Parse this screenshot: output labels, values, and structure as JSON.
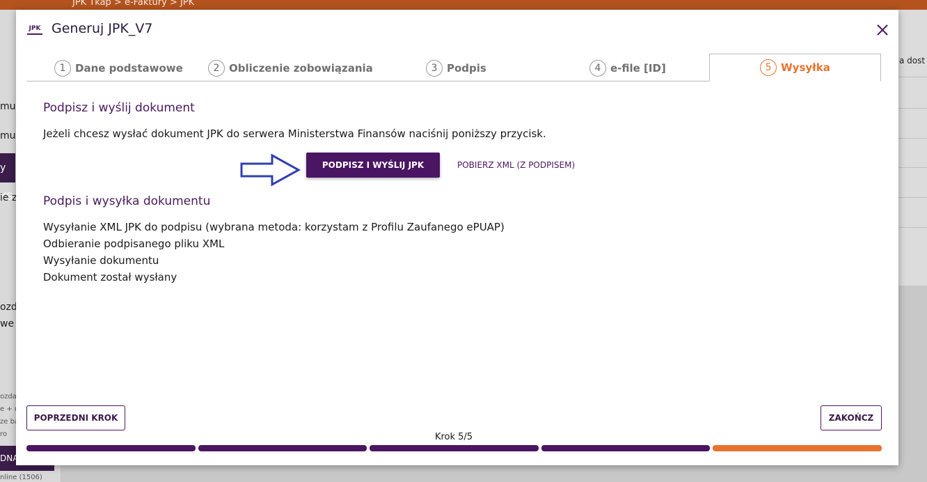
{
  "background": {
    "breadcrumb": "JPK   Tkap  >  e-Faktury  >  JPK",
    "left_texts": [
      "mul",
      "mul",
      "ie z",
      "ozda",
      "we"
    ],
    "left_small": [
      "ozdan",
      "e + n",
      "ze ba",
      "ro",
      "nline (1506)"
    ],
    "left_button_1": "y KS",
    "left_button_2": "DNA",
    "right_text": "a dost"
  },
  "modal": {
    "logo_text": "JPK",
    "title": "Generuj JPK_V7",
    "steps": [
      {
        "num": "1",
        "label": "Dane podstawowe"
      },
      {
        "num": "2",
        "label": "Obliczenie zobowiązania"
      },
      {
        "num": "3",
        "label": "Podpis"
      },
      {
        "num": "4",
        "label": "e-file [ID]"
      },
      {
        "num": "5",
        "label": "Wysyłka"
      }
    ],
    "section1_title": "Podpisz i wyślij dokument",
    "instruction": "Jeżeli chcesz wysłać dokument JPK do serwera Ministerstwa Finansów naciśnij poniższy przycisk.",
    "primary_button": "PODPISZ I WYŚLIJ JPK",
    "download_link": "POBIERZ XML (Z PODPISEM)",
    "section2_title": "Podpis i wysyłka dokumentu",
    "log": [
      "Wysyłanie XML JPK do podpisu (wybrana metoda: korzystam z Profilu Zaufanego ePUAP)",
      "Odbieranie podpisanego pliku XML",
      "Wysyłanie dokumentu",
      "Dokument został wysłany"
    ],
    "prev_button": "POPRZEDNI KROK",
    "finish_button": "ZAKOŃCZ",
    "step_counter": "Krok 5/5",
    "progress": {
      "current_step": 5,
      "total_steps": 5
    }
  },
  "colors": {
    "primary": "#4a1562",
    "accent": "#e8722e",
    "arrow": "#2f3fb4"
  }
}
